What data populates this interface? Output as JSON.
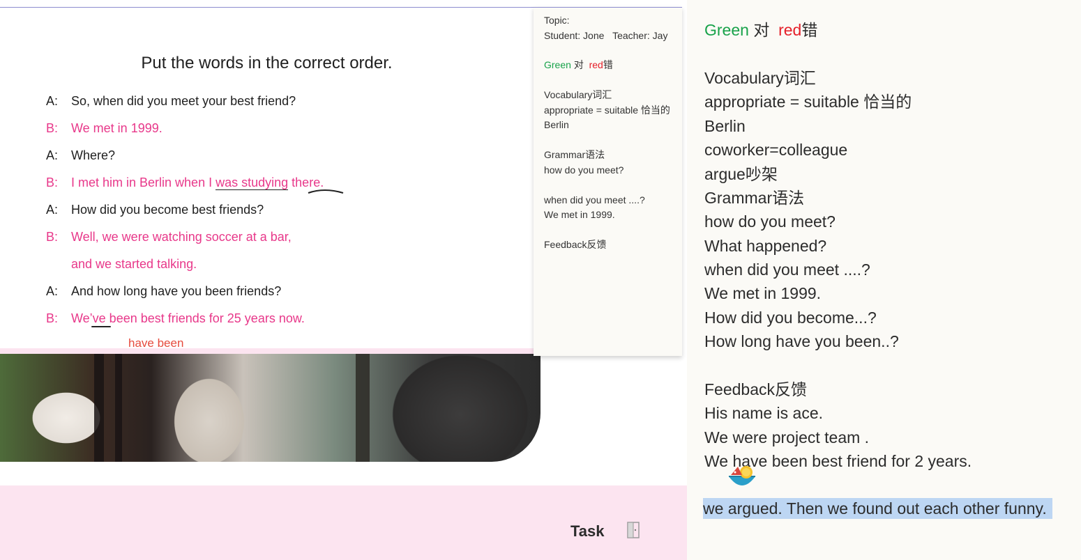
{
  "slide": {
    "title": "Put the words in the correct order.",
    "dialogue": [
      {
        "speaker": "A:",
        "text": "So, when did you meet your best friend?"
      },
      {
        "speaker": "B:",
        "text": "We met in 1999."
      },
      {
        "speaker": "A:",
        "text": "Where?"
      },
      {
        "speaker": "B:",
        "text_before": "I met him in Berlin when I ",
        "text_u1": "was studying",
        "text_mid": " ",
        "text_u2": "there.",
        "text_after": ""
      },
      {
        "speaker": "A:",
        "text": "How did you become best friends?"
      },
      {
        "speaker": "B:",
        "text": "Well, we were watching soccer at a bar,"
      },
      {
        "speaker": "",
        "text": "and we started talking."
      },
      {
        "speaker": "A:",
        "text": "And how long have you been friends?"
      },
      {
        "speaker": "B:",
        "text": "We’ve been best friends for 25 years now."
      }
    ],
    "correction": "have been"
  },
  "task": {
    "label": "Task"
  },
  "notes_panel": {
    "topic": "Topic:",
    "student": "Student: Jone",
    "teacher": "Teacher: Jay",
    "green": "Green",
    "green_cn": "对",
    "red": "red",
    "red_cn": "错",
    "vocab_heading": "Vocabulary词汇",
    "vocab_1": "appropriate = suitable 恰当的",
    "vocab_2": "Berlin",
    "grammar_heading": "Grammar语法",
    "grammar_1": "how do you meet?",
    "grammar_2": "when did you meet ....?",
    "grammar_3": "We met in 1999.",
    "feedback_heading": "Feedback反馈"
  },
  "right_notes": {
    "green": "Green",
    "green_cn": "对",
    "red": "red",
    "red_cn": "错",
    "lines": [
      "Vocabulary词汇",
      "appropriate = suitable 恰当的",
      "Berlin",
      "coworker=colleague",
      "argue吵架",
      "Grammar语法",
      "how do you meet?",
      "What happened?",
      "when did you meet ....?",
      "We met in 1999.",
      "How did you become...?",
      "How long have you been..?",
      "",
      "Feedback反馈",
      "His name is  ace.",
      "We were project team .",
      "We have been best friend for 2 years."
    ],
    "selected_line": "we argued. Then we found out each other funny."
  },
  "colors": {
    "green": "#18a24a",
    "red": "#e5202a",
    "pink_text": "#e8388a",
    "selection": "#bdd6f3",
    "task_bar": "#fce4f0"
  }
}
